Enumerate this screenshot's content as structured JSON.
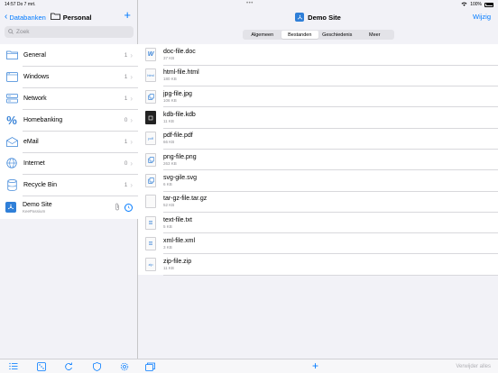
{
  "status": {
    "time": "14:57",
    "date": "Do 7 mrt.",
    "battery": "100%"
  },
  "sidebar": {
    "back_label": "Databanken",
    "title": "Personal",
    "search_placeholder": "Zoek",
    "groups": [
      {
        "label": "General",
        "count": "1",
        "icon": "folder-icon"
      },
      {
        "label": "Windows",
        "count": "1",
        "icon": "windows-icon"
      },
      {
        "label": "Network",
        "count": "1",
        "icon": "network-server-icon"
      },
      {
        "label": "Homebanking",
        "count": "0",
        "icon": "percent-icon"
      },
      {
        "label": "eMail",
        "count": "1",
        "icon": "envelope-icon"
      },
      {
        "label": "Internet",
        "count": "0",
        "icon": "globe-icon"
      },
      {
        "label": "Recycle Bin",
        "count": "1",
        "icon": "trash-db-icon"
      }
    ],
    "entry": {
      "title": "Demo Site",
      "subtitle": "KeePassium"
    }
  },
  "main": {
    "title": "Demo Site",
    "edit_label": "Wijzig",
    "tabs": [
      {
        "label": "Algemeen",
        "active": false
      },
      {
        "label": "Bestanden",
        "active": true
      },
      {
        "label": "Geschiedenis",
        "active": false
      },
      {
        "label": "Meer",
        "active": false
      }
    ],
    "files": [
      {
        "name": "doc-file.doc",
        "size": "37 KB",
        "icon": "W"
      },
      {
        "name": "html-file.html",
        "size": "180 KB",
        "icon": "html"
      },
      {
        "name": "jpg-file.jpg",
        "size": "106 KB",
        "icon": "img"
      },
      {
        "name": "kdb-file.kdb",
        "size": "11 KB",
        "icon": "kdb"
      },
      {
        "name": "pdf-file.pdf",
        "size": "66 KB",
        "icon": "pdf"
      },
      {
        "name": "png-file.png",
        "size": "263 KB",
        "icon": "img"
      },
      {
        "name": "svg-gile.svg",
        "size": "6 KB",
        "icon": "img"
      },
      {
        "name": "tar-gz-file.tar.gz",
        "size": "52 KB",
        "icon": ""
      },
      {
        "name": "text-file.txt",
        "size": "5 KB",
        "icon": "txt"
      },
      {
        "name": "xml-file.xml",
        "size": "3 KB",
        "icon": "txt"
      },
      {
        "name": "zip-file.zip",
        "size": "11 KB",
        "icon": "zip"
      }
    ],
    "remove_all_label": "Verwijder alles"
  },
  "colors": {
    "accent": "#007aff",
    "background": "#f2f2f7",
    "entry_icon": "#2f7fd8"
  }
}
